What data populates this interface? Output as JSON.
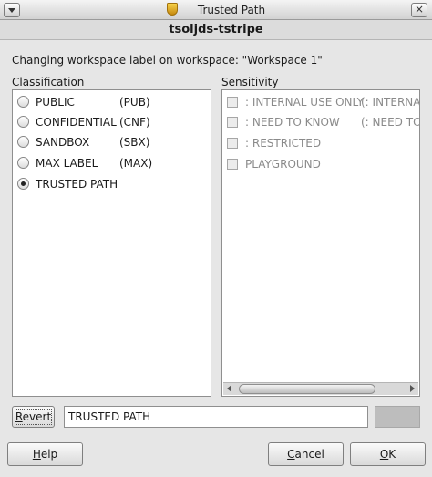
{
  "window": {
    "title": "Trusted Path",
    "menu_icon": "chevron-down-icon",
    "close_glyph": "×",
    "shield_icon": "shield-icon"
  },
  "trusted_bar": {
    "text": "tsoljds-tstripe"
  },
  "message": "Changing workspace label on workspace: \"Workspace 1\"",
  "classification": {
    "label": "Classification",
    "selected": "TRUSTED PATH",
    "items": [
      {
        "name": "PUBLIC",
        "abbr": "(PUB)",
        "selected": false
      },
      {
        "name": "CONFIDENTIAL",
        "abbr": "(CNF)",
        "selected": false
      },
      {
        "name": "SANDBOX",
        "abbr": "(SBX)",
        "selected": false
      },
      {
        "name": "MAX LABEL",
        "abbr": "(MAX)",
        "selected": false
      },
      {
        "name": "TRUSTED PATH",
        "abbr": "",
        "selected": true
      }
    ]
  },
  "sensitivity": {
    "label": "Sensitivity",
    "items": [
      {
        "name": ": INTERNAL USE ONLY",
        "abbr": "(: INTERNAL",
        "enabled": false
      },
      {
        "name": ": NEED TO KNOW",
        "abbr": "(: NEED TO",
        "enabled": false
      },
      {
        "name": ": RESTRICTED",
        "abbr": "",
        "enabled": false
      },
      {
        "name": "PLAYGROUND",
        "abbr": "",
        "enabled": false
      }
    ]
  },
  "revert": {
    "mnemonic": "R",
    "rest": "evert"
  },
  "label_value": "TRUSTED PATH",
  "colors": {
    "label_swatch": "#bdbdbd"
  },
  "buttons": {
    "help": {
      "mnemonic": "H",
      "rest": "elp"
    },
    "cancel": {
      "mnemonic": "C",
      "rest": "ancel"
    },
    "ok": {
      "mnemonic": "O",
      "rest": "K"
    }
  }
}
